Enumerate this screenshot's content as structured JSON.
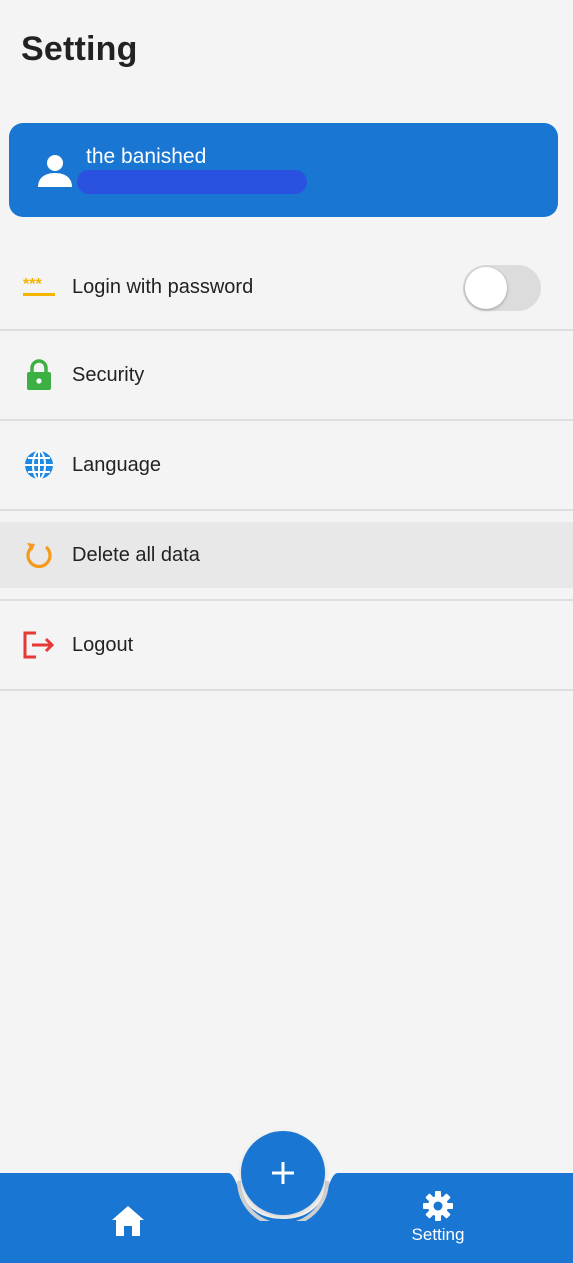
{
  "header": {
    "title": "Setting"
  },
  "profile": {
    "username": "the banished"
  },
  "menu": {
    "items": [
      {
        "id": "login-password",
        "label": "Login with password",
        "icon": "password-icon",
        "toggle": false
      },
      {
        "id": "security",
        "label": "Security",
        "icon": "lock-icon"
      },
      {
        "id": "language",
        "label": "Language",
        "icon": "globe-icon"
      },
      {
        "id": "delete-data",
        "label": "Delete all data",
        "icon": "reset-icon",
        "highlighted": true
      },
      {
        "id": "logout",
        "label": "Logout",
        "icon": "logout-icon"
      }
    ]
  },
  "bottom_nav": {
    "home_icon": "home-icon",
    "setting_label": "Setting",
    "setting_icon": "gear-icon",
    "fab_icon": "plus-icon"
  },
  "colors": {
    "primary": "#1976d2",
    "background": "#f4f4f4",
    "password_icon": "#f5b400",
    "lock_icon": "#3cb043",
    "globe_icon": "#1e88e5",
    "reset_icon": "#f59a1b",
    "logout_icon": "#e53935"
  }
}
